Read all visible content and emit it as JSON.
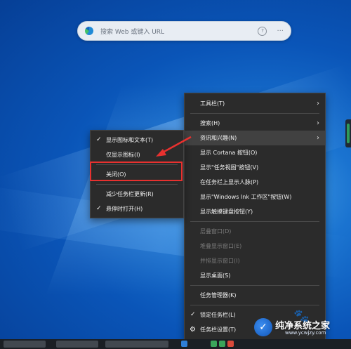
{
  "search": {
    "placeholder": "搜索 Web 或键入 URL",
    "help_icon": "?",
    "more_icon": "···"
  },
  "main_menu": {
    "items": [
      {
        "label": "工具栏(T)",
        "submenu": true,
        "enabled": true
      },
      {
        "label": "搜索(H)",
        "submenu": true,
        "enabled": true
      },
      {
        "label": "资讯和兴趣(N)",
        "submenu": true,
        "enabled": true,
        "highlighted": true
      },
      {
        "label": "显示 Cortana 按钮(O)",
        "enabled": true
      },
      {
        "label": "显示\"任务视图\"按钮(V)",
        "enabled": true
      },
      {
        "label": "在任务栏上显示人脉(P)",
        "enabled": true
      },
      {
        "label": "显示\"Windows Ink 工作区\"按钮(W)",
        "enabled": true
      },
      {
        "label": "显示触摸键盘按钮(Y)",
        "enabled": true
      },
      {
        "label": "层叠窗口(D)",
        "enabled": false
      },
      {
        "label": "堆叠显示窗口(E)",
        "enabled": false
      },
      {
        "label": "并排显示窗口(I)",
        "enabled": false
      },
      {
        "label": "显示桌面(S)",
        "enabled": true
      },
      {
        "label": "任务管理器(K)",
        "enabled": true
      },
      {
        "label": "锁定任务栏(L)",
        "checked": true,
        "enabled": true
      },
      {
        "label": "任务栏设置(T)",
        "icon": "gear-icon",
        "enabled": true
      }
    ]
  },
  "sub_menu": {
    "items": [
      {
        "label": "显示图标和文本(T)",
        "checked": true
      },
      {
        "label": "仅显示图标(I)",
        "checked": false
      },
      {
        "label": "关闭(O)",
        "checked": false,
        "annotated": true
      },
      {
        "label": "减少任务栏更新(R)",
        "checked": false
      },
      {
        "label": "悬停时打开(H)",
        "checked": true
      }
    ]
  },
  "annotation": {
    "box_color": "#e8312f",
    "arrow_color": "#e8312f"
  },
  "watermark": {
    "title": "纯净系统之家",
    "url": "www.ycwjzy.com"
  },
  "icons": {
    "chevron": "chevron-right-icon",
    "check": "check-icon",
    "gear": "gear-icon"
  }
}
